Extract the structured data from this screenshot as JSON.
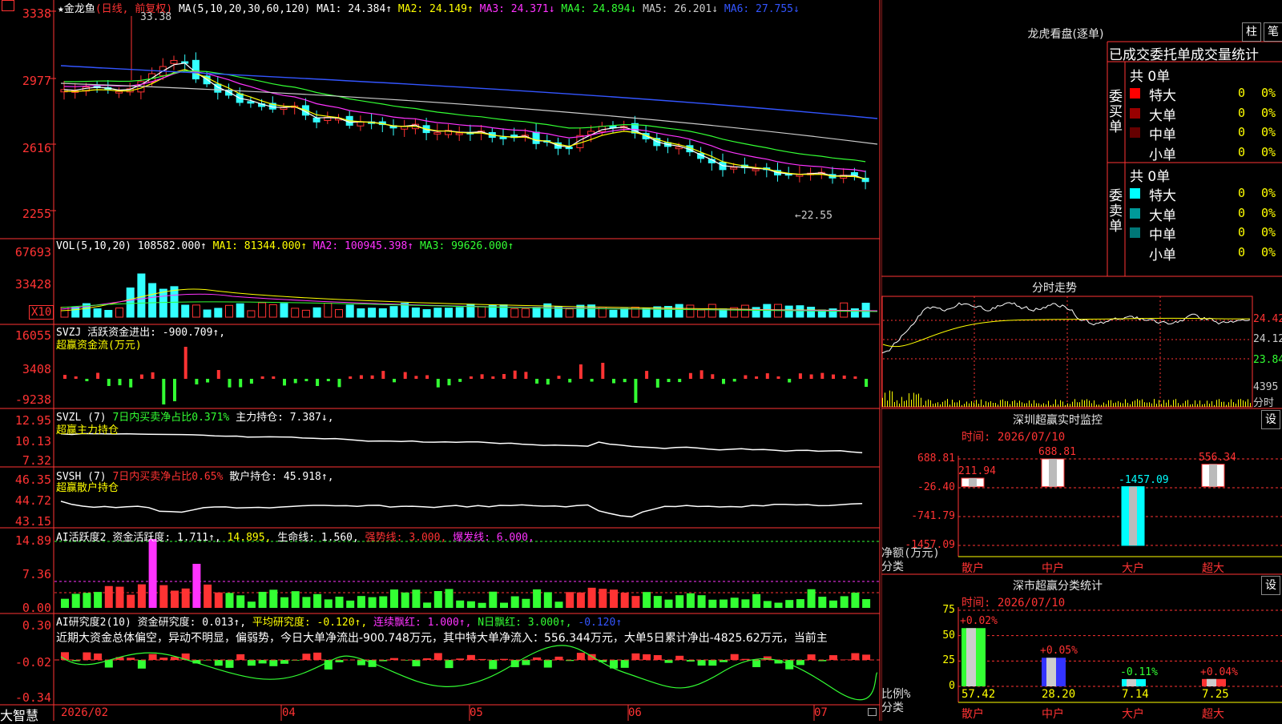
{
  "stock": {
    "title": "★金龙鱼",
    "period": "(日线, 前复权)",
    "ma_header": "MA(5,10,20,30,60,120)",
    "ma_values": [
      {
        "label": "MA1: 24.384↑",
        "color": "#ffffff"
      },
      {
        "label": "MA2: 24.149↑",
        "color": "#ffff00"
      },
      {
        "label": "MA3: 24.371↓",
        "color": "#ff33ff"
      },
      {
        "label": "MA4: 24.894↓",
        "color": "#33ff33"
      },
      {
        "label": "MA5: 26.201↓",
        "color": "#cccccc"
      },
      {
        "label": "MA6: 27.755↓",
        "color": "#3355ff"
      }
    ],
    "price_axis": [
      "3338",
      "2977",
      "2616",
      "2255"
    ],
    "high_label": "33.38",
    "low_label": "←22.55"
  },
  "volume": {
    "header": "VOL(5,10,20)",
    "values": [
      {
        "label": "108582.000↑",
        "color": "#ffffff"
      },
      {
        "label": "MA1: 81344.000↑",
        "color": "#ffff00"
      },
      {
        "label": "MA2: 100945.398↑",
        "color": "#ff33ff"
      },
      {
        "label": "MA3: 99626.000↑",
        "color": "#33ff33"
      }
    ],
    "axis": [
      "67693",
      "33428"
    ],
    "unit": "X10"
  },
  "svzj": {
    "header": "SVZJ",
    "value_label": "活跃资金进出: -900.709↑,",
    "subtitle": "超赢资金流(万元)",
    "axis": [
      "16055",
      "3408",
      "-9238"
    ]
  },
  "svzl": {
    "header": "SVZL (7)",
    "ratio_label": "7日内买卖净占比0.371%",
    "value_label": "主力持仓: 7.387↓,",
    "subtitle": "超赢主力持仓",
    "axis": [
      "12.95",
      "10.13",
      "7.32"
    ]
  },
  "svsh": {
    "header": "SVSH (7)",
    "ratio_label": "7日内买卖净占比0.65%",
    "value_label": "散户持仓: 45.918↑,",
    "subtitle": "超赢散户持仓",
    "axis": [
      "46.35",
      "44.72",
      "43.15"
    ]
  },
  "ai_active": {
    "header": "AI活跃度2",
    "values": [
      {
        "label": "资金活跃度: 1.711↑,",
        "color": "#ffffff"
      },
      {
        "label": "14.895,",
        "color": "#ffff00"
      },
      {
        "label": "生命线: 1.560,",
        "color": "#ffffff"
      },
      {
        "label": "强势线: 3.000,",
        "color": "#ff3333"
      },
      {
        "label": "爆发线: 6.000,",
        "color": "#ff33ff"
      }
    ],
    "axis": [
      "14.89",
      "7.36",
      "0.00"
    ]
  },
  "ai_research": {
    "header": "AI研究度2(10)",
    "values": [
      {
        "label": "资金研究度: 0.013↑,",
        "color": "#ffffff"
      },
      {
        "label": "平均研究度: -0.120↑,",
        "color": "#ffff00"
      },
      {
        "label": "连续飘红: 1.000↑,",
        "color": "#ff33ff"
      },
      {
        "label": "N日飘红: 3.000↑,",
        "color": "#33ff33"
      },
      {
        "label": "-0.120↑",
        "color": "#3355ff"
      }
    ],
    "description": "近期大资金总体偏空，异动不明显，偏弱势，今日大单净流出-900.748万元，其中特大单净流入：556.344万元，大单5日累计净出-4825.62万元，当前主",
    "axis": [
      "0.30",
      "-0.02",
      "-0.34"
    ]
  },
  "bottom": {
    "brand": "大智慧",
    "dates": [
      "2026/02",
      "04",
      "05",
      "06",
      "07"
    ]
  },
  "dragon": {
    "title": "龙虎看盘(逐单)",
    "btn_zhu": "柱",
    "btn_bi": "笔",
    "tabs": "已成交委托单成交量统计",
    "buy_title": "委买单",
    "sell_title": "委卖单",
    "buy_total": "共 0单",
    "sell_total": "共 0单",
    "buy_rows": [
      {
        "name": "特大",
        "count": "0",
        "pct": "0%",
        "color": "#ff0000"
      },
      {
        "name": "大单",
        "count": "0",
        "pct": "0%",
        "color": "#990000"
      },
      {
        "name": "中单",
        "count": "0",
        "pct": "0%",
        "color": "#660000"
      },
      {
        "name": "小单",
        "count": "0",
        "pct": "0%",
        "color": "#000000"
      }
    ],
    "sell_rows": [
      {
        "name": "特大",
        "count": "0",
        "pct": "0%",
        "color": "#00ffff"
      },
      {
        "name": "大单",
        "count": "0",
        "pct": "0%",
        "color": "#009999"
      },
      {
        "name": "中单",
        "count": "0",
        "pct": "0%",
        "color": "#007777"
      },
      {
        "name": "小单",
        "count": "0",
        "pct": "0%",
        "color": "#000000"
      }
    ]
  },
  "intraday": {
    "title": "分时走势",
    "price_axis": [
      "24.42",
      "24.12",
      "23.84"
    ],
    "volume_label": "4395",
    "unit_label": "分时"
  },
  "sz_monitor": {
    "title": "深圳超赢实时监控",
    "settings": "设",
    "time": "时间: 2026/07/10",
    "axis": [
      "688.81",
      "-26.40",
      "-741.79",
      "-1457.09"
    ],
    "y_title": "净额(万元)",
    "x_title": "分类",
    "categories": [
      "散户",
      "中户",
      "大户",
      "超大"
    ],
    "values": [
      211.94,
      688.81,
      -1457.09,
      556.34
    ],
    "value_labels": [
      "211.94",
      "688.81",
      "-1457.09",
      "556.34"
    ]
  },
  "sz_stats": {
    "title": "深市超赢分类统计",
    "settings": "设",
    "time": "时间: 2026/07/10",
    "axis": [
      "75",
      "50",
      "25",
      "0"
    ],
    "y_title": "比例%",
    "x_title": "分类",
    "categories": [
      "散户",
      "中户",
      "大户",
      "超大"
    ],
    "values": [
      57.42,
      28.2,
      7.14,
      7.25
    ],
    "value_labels": [
      "57.42",
      "28.20",
      "7.14",
      "7.25"
    ],
    "change_labels": [
      "+0.02%",
      "+0.05%",
      "-0.11%",
      "+0.04%"
    ]
  }
}
